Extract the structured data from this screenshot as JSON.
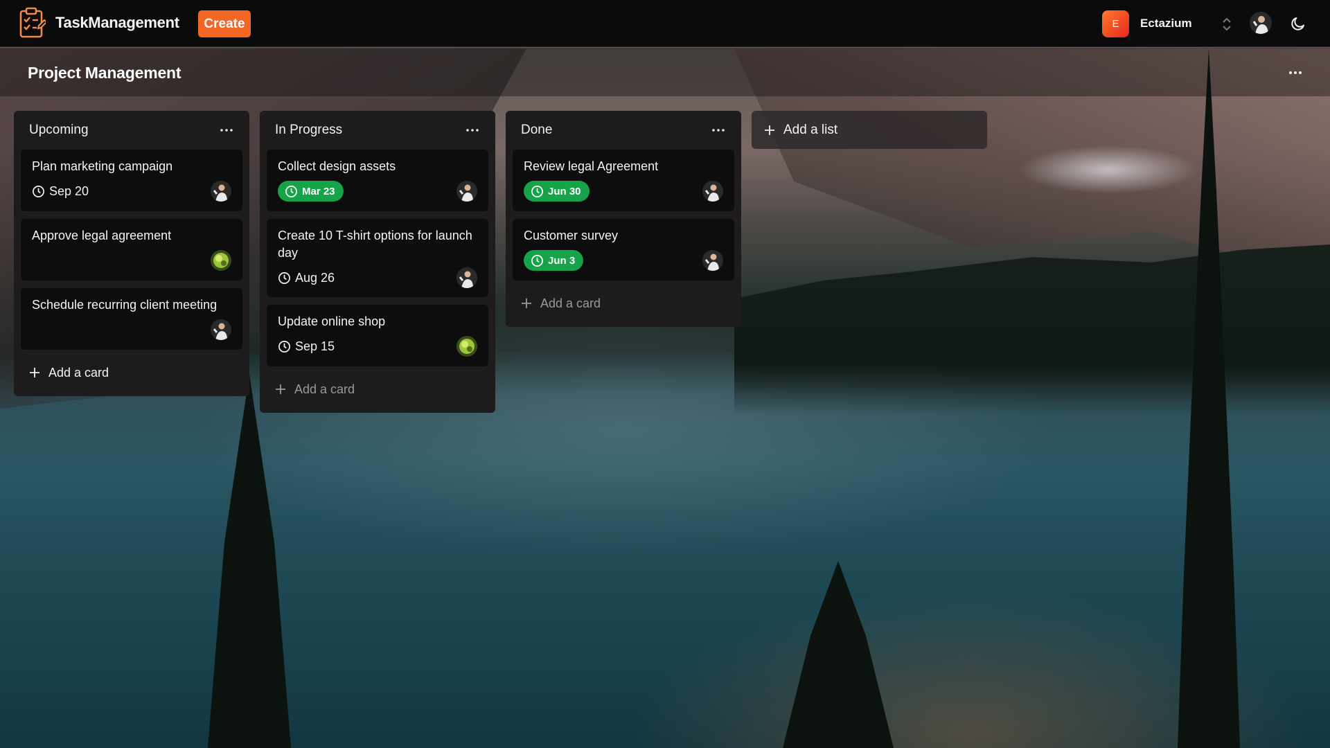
{
  "app": {
    "brand": "TaskManagement",
    "create_label": "Create"
  },
  "workspace": {
    "initial": "E",
    "name": "Ectazium"
  },
  "board": {
    "title": "Project Management"
  },
  "lists": [
    {
      "title": "Upcoming",
      "cards": [
        {
          "title": "Plan marketing campaign",
          "date": "Sep 20",
          "date_style": "plain",
          "avatar": "person"
        },
        {
          "title": "Approve legal agreement",
          "date": "",
          "date_style": "none",
          "avatar": "nature"
        },
        {
          "title": "Schedule recurring client meeting",
          "date": "",
          "date_style": "none",
          "avatar": "person"
        }
      ],
      "add_card_label": "Add a card"
    },
    {
      "title": "In Progress",
      "cards": [
        {
          "title": "Collect design assets",
          "date": "Mar 23",
          "date_style": "badge-green",
          "avatar": "person"
        },
        {
          "title": "Create 10 T-shirt options for launch day",
          "date": "Aug 26",
          "date_style": "plain",
          "avatar": "person"
        },
        {
          "title": "Update online shop",
          "date": "Sep 15",
          "date_style": "plain",
          "avatar": "nature"
        }
      ],
      "add_card_label": "Add a card"
    },
    {
      "title": "Done",
      "cards": [
        {
          "title": "Review legal Agreement",
          "date": "Jun 30",
          "date_style": "badge-green",
          "avatar": "person"
        },
        {
          "title": "Customer survey",
          "date": "Jun 3",
          "date_style": "badge-green",
          "avatar": "person"
        }
      ],
      "add_card_label": "Add a card"
    }
  ],
  "add_list_label": "Add a list",
  "colors": {
    "accent": "#f26522",
    "due_badge": "#16a34a",
    "card_bg": "#0d0d0d",
    "list_bg": "#1d1b1c"
  },
  "icons": [
    "clipboard-logo-icon",
    "chevron-updown-icon",
    "moon-icon",
    "more-dots-icon",
    "clock-icon",
    "plus-icon"
  ]
}
